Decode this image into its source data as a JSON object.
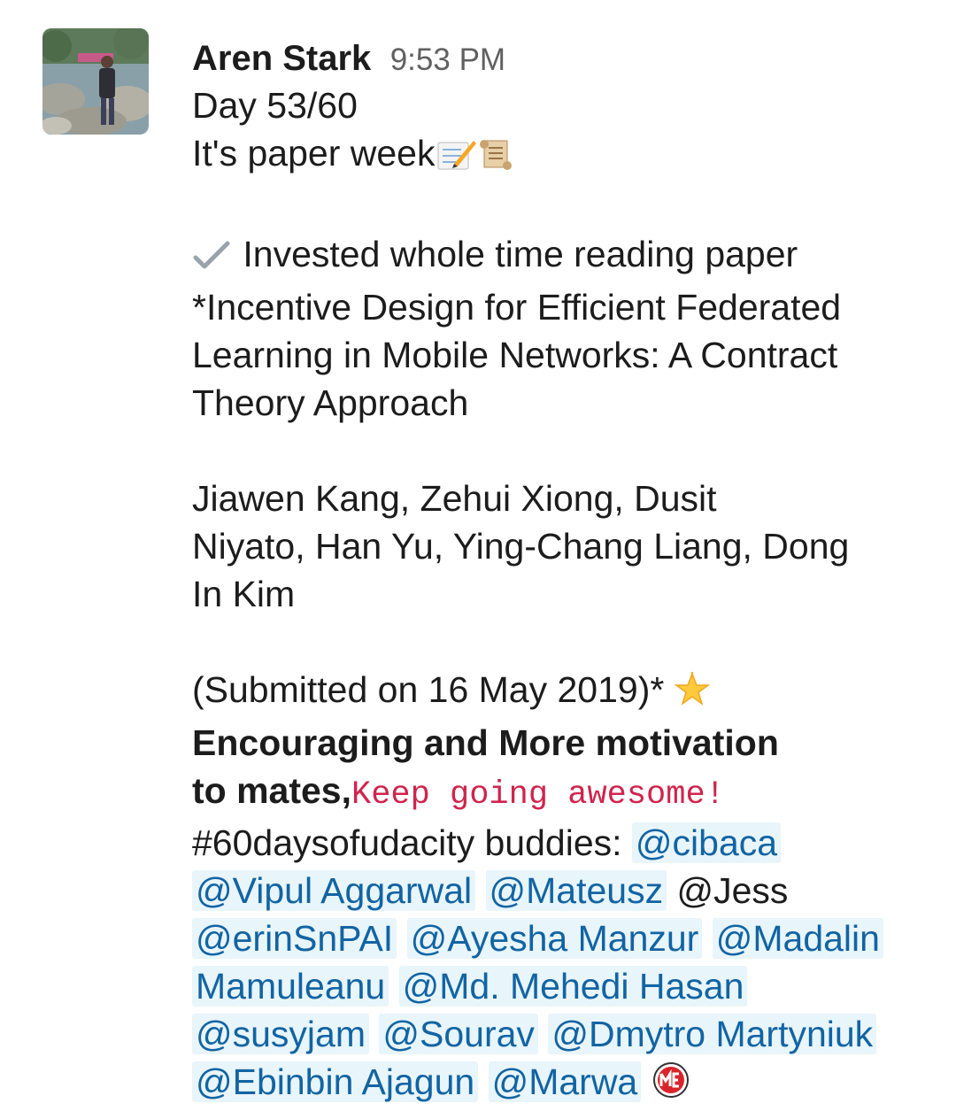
{
  "message": {
    "sender": "Aren Stark",
    "timestamp": "9:53 PM",
    "line_day": "Day 53/60",
    "line_week": "It's paper week",
    "line_invested": "Invested whole time reading paper",
    "title_1": "*Incentive Design for Efficient Federated",
    "title_2": "Learning in Mobile Networks: A Contract",
    "title_3": "Theory Approach",
    "authors_1": "Jiawen Kang, Zehui Xiong, Dusit",
    "authors_2": "Niyato, Han Yu, Ying-Chang Liang, Dong",
    "authors_3": "In Kim",
    "submitted": "(Submitted on 16 May 2019)*",
    "bold_1": "Encouraging and More motivation",
    "bold_2": "to mates,",
    "code_text": "Keep going awesome!",
    "hashtag": "#60daysofudacity buddies:",
    "mentions": [
      "@cibaca",
      "@Vipul Aggarwal",
      "@Mateusz",
      "@Jess",
      "@erinSnPAI",
      "@Ayesha Manzur",
      "@Madalin",
      "Mamuleanu",
      "@Md. Mehedi Hasan",
      "@susyjam",
      "@Sourav",
      "@Dmytro Martyniuk",
      "@Ebinbin Ajagun",
      "@Marwa"
    ]
  },
  "icons": [
    "memo-icon",
    "scroll-icon",
    "check-mark-icon",
    "star-icon",
    "me-emoji-icon"
  ],
  "colors": {
    "mention_text": "#1264a3",
    "mention_bg": "#e8f5fa",
    "code_text": "#d0244d",
    "timestamp": "#616061"
  }
}
